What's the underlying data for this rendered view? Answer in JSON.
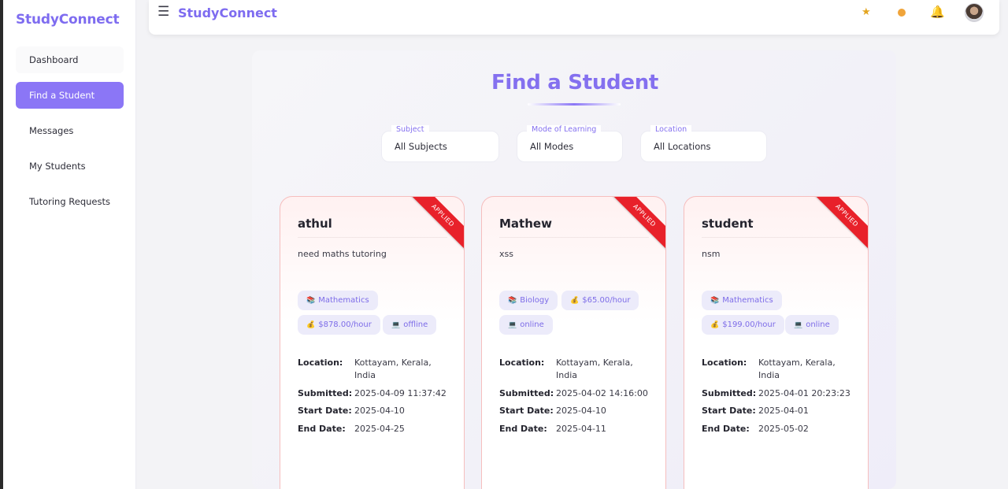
{
  "sidebar": {
    "brand": "StudyConnect",
    "items": [
      {
        "label": "Dashboard"
      },
      {
        "label": "Find a Student"
      },
      {
        "label": "Messages"
      },
      {
        "label": "My Students"
      },
      {
        "label": "Tutoring Requests"
      }
    ],
    "active_index": 1
  },
  "topbar": {
    "menu_icon": "☰",
    "brand": "StudyConnect",
    "icons": [
      "star-icon",
      "dot-icon",
      "bell-icon",
      "avatar"
    ]
  },
  "page": {
    "title": "Find a Student"
  },
  "filters": [
    {
      "label": "Subject",
      "value": "All Subjects"
    },
    {
      "label": "Mode of Learning",
      "value": "All Modes"
    },
    {
      "label": "Location",
      "value": "All Locations"
    }
  ],
  "labels": {
    "location": "Location:",
    "submitted": "Submitted:",
    "start_date": "Start Date:",
    "end_date": "End Date:"
  },
  "cards": [
    {
      "badge": "APPLIED",
      "name": "athul",
      "description": "need maths tutoring",
      "subject": "Mathematics",
      "rate": "$878.00/hour",
      "mode": "offline",
      "location": "Kottayam, Kerala, India",
      "submitted": "2025-04-09 11:37:42",
      "start_date": "2025-04-10",
      "end_date": "2025-04-25"
    },
    {
      "badge": "APPLIED",
      "name": "Mathew",
      "description": "xss",
      "subject": "Biology",
      "rate": "$65.00/hour",
      "mode": "online",
      "location": "Kottayam, Kerala, India",
      "submitted": "2025-04-02 14:16:00",
      "start_date": "2025-04-10",
      "end_date": "2025-04-11"
    },
    {
      "badge": "APPLIED",
      "name": "student",
      "description": "nsm",
      "subject": "Mathematics",
      "rate": "$199.00/hour",
      "mode": "online",
      "location": "Kottayam, Kerala, India",
      "submitted": "2025-04-01 20:23:23",
      "start_date": "2025-04-01",
      "end_date": "2025-05-02"
    }
  ],
  "colors": {
    "accent": "#8b76f6",
    "brand_text": "#7e6cf0",
    "ribbon": "#e8212a",
    "tag_bg": "#ecebfa"
  }
}
